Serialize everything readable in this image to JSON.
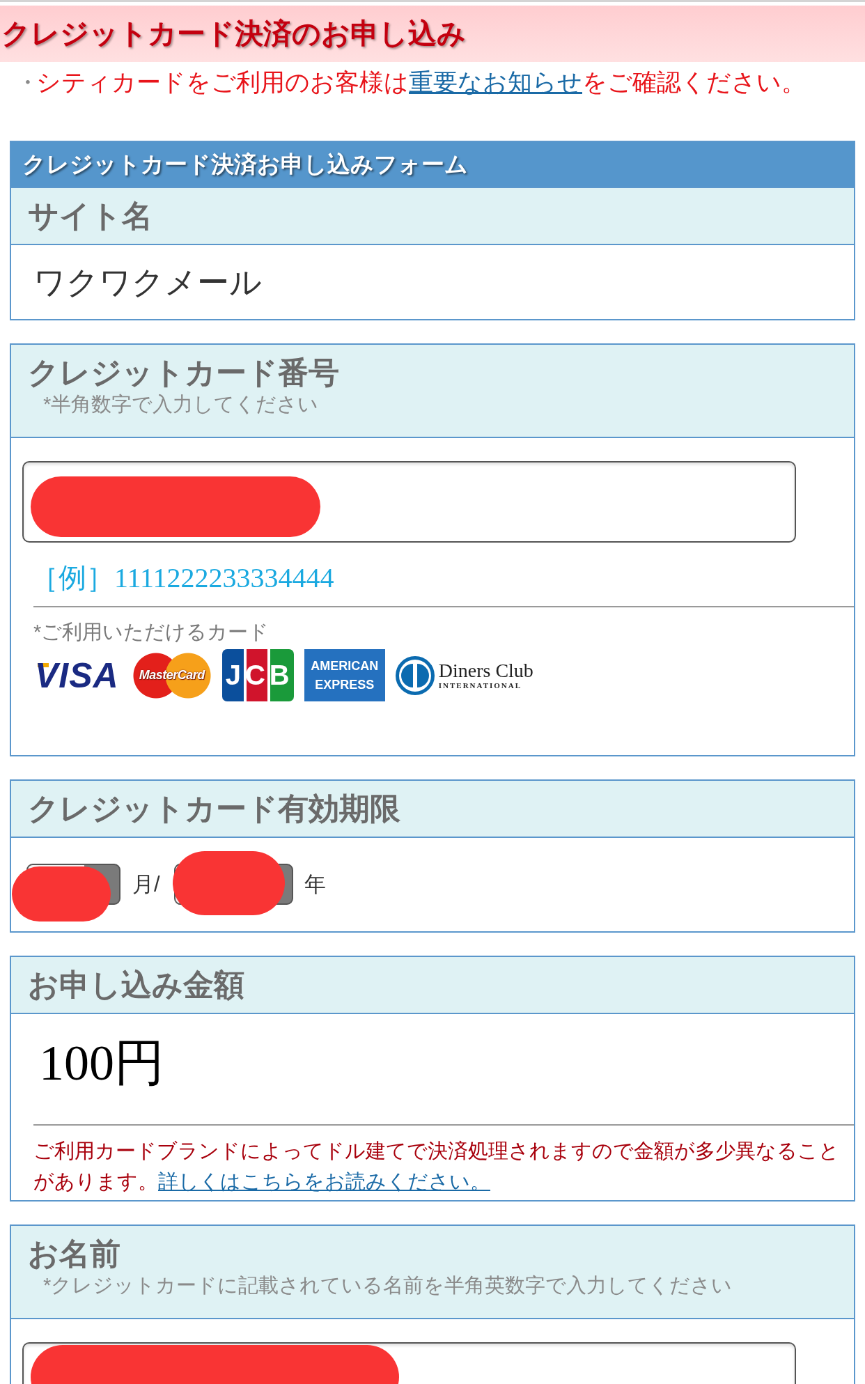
{
  "page_header": {
    "title": "クレジットカード決済のお申し込み"
  },
  "notice": {
    "bullet": "・",
    "text_before": "シティカードをご利用のお客様は",
    "link": "重要なお知らせ",
    "text_after": "をご確認ください。"
  },
  "form": {
    "title": "クレジットカード決済お申し込みフォーム",
    "sections": [
      {
        "kind": "display",
        "label": "サイト名",
        "value": "ワクワクメール"
      },
      {
        "kind": "card_number",
        "label": "クレジットカード番号",
        "note": "*半角数字で入力してください",
        "input": {
          "redacted": true
        },
        "example": "［例］1111222233334444",
        "cards_note": "*ご利用いただけるカード",
        "cards": [
          {
            "kind": "visa",
            "label": "VISA"
          },
          {
            "kind": "mastercard",
            "label": "MasterCard"
          },
          {
            "kind": "jcb",
            "label": "JCB"
          },
          {
            "kind": "amex",
            "label": "AMERICAN",
            "sublabel": "EXPRESS"
          },
          {
            "kind": "diners",
            "label": "Diners Club",
            "sublabel": "INTERNATIONAL"
          }
        ]
      },
      {
        "kind": "expiry",
        "label": "クレジットカード有効期限",
        "month": {
          "redacted": true
        },
        "month_unit": "月/",
        "year": {
          "redacted": true
        },
        "year_unit": "年"
      },
      {
        "kind": "amount",
        "label": "お申し込み金額",
        "value": "100円",
        "note": "ご利用カードブランドによってドル建てで決済処理されますので金額が多少異なることがあります。",
        "link": "詳しくはこちらをお読みください。"
      },
      {
        "kind": "text_input",
        "label": "お名前",
        "note": "*クレジットカードに記載されている名前を半角英数字で入力してください",
        "input": {
          "redacted": true
        }
      }
    ]
  }
}
